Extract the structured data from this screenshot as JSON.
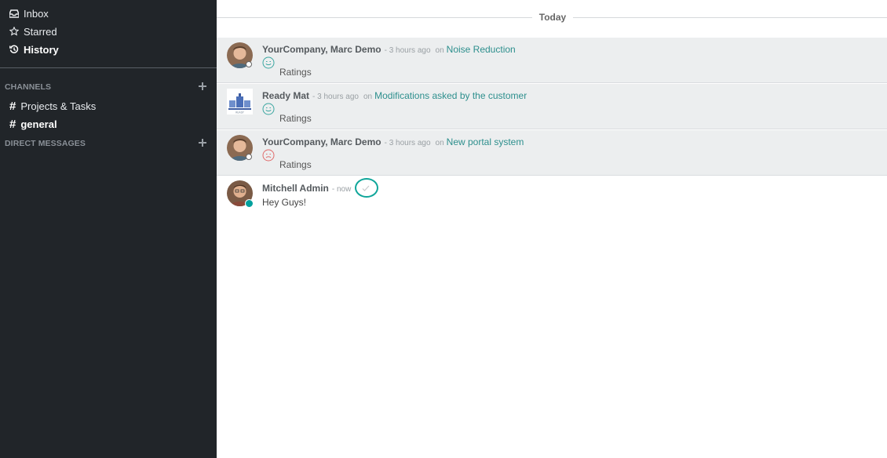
{
  "sidebar": {
    "nav": [
      {
        "label": "Inbox",
        "icon": "inbox-icon"
      },
      {
        "label": "Starred",
        "icon": "star-icon"
      },
      {
        "label": "History",
        "icon": "history-icon"
      }
    ],
    "channels_title": "CHANNELS",
    "channels": [
      {
        "label": "Projects & Tasks"
      },
      {
        "label": "general"
      }
    ],
    "dm_title": "DIRECT MESSAGES"
  },
  "main": {
    "divider": "Today",
    "messages": [
      {
        "author": "YourCompany, Marc Demo",
        "time": "- 3 hours ago",
        "on": "on",
        "record": "Noise Reduction",
        "rating": "Ratings",
        "rating_icon": "smile-icon",
        "rating_color": "#3aa6a0",
        "status": "offline"
      },
      {
        "author": "Ready Mat",
        "time": "- 3 hours ago",
        "on": "on",
        "record": "Modifications asked by the customer",
        "rating": "Ratings",
        "rating_icon": "smile-icon",
        "rating_color": "#3aa6a0",
        "status": "none"
      },
      {
        "author": "YourCompany, Marc Demo",
        "time": "- 3 hours ago",
        "on": "on",
        "record": "New portal system",
        "rating": "Ratings",
        "rating_icon": "frown-icon",
        "rating_color": "#e06a6a",
        "status": "offline"
      },
      {
        "author": "Mitchell Admin",
        "time": "- now",
        "body": "Hey Guys!",
        "status": "online"
      }
    ]
  },
  "colors": {
    "sidebar_bg": "#212529",
    "link": "#2d8f8d",
    "online": "#00a09d",
    "highlight": "#10a69a"
  }
}
